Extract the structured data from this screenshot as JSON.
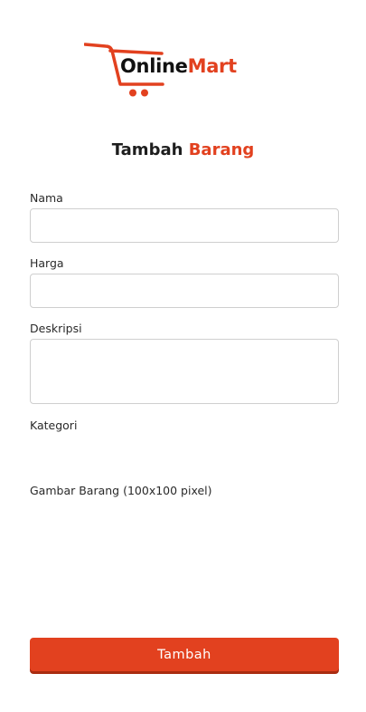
{
  "brand": {
    "name_part1": "Online",
    "name_part2": "Mart",
    "icon": "shopping-cart-icon",
    "accent_color": "#e2411f"
  },
  "title": {
    "part1": "Tambah",
    "part2": "Barang"
  },
  "form": {
    "nama": {
      "label": "Nama",
      "value": ""
    },
    "harga": {
      "label": "Harga",
      "value": ""
    },
    "deskripsi": {
      "label": "Deskripsi",
      "value": ""
    },
    "kategori": {
      "label": "Kategori"
    },
    "gambar": {
      "label": "Gambar Barang (100x100 pixel)"
    }
  },
  "submit_label": "Tambah"
}
